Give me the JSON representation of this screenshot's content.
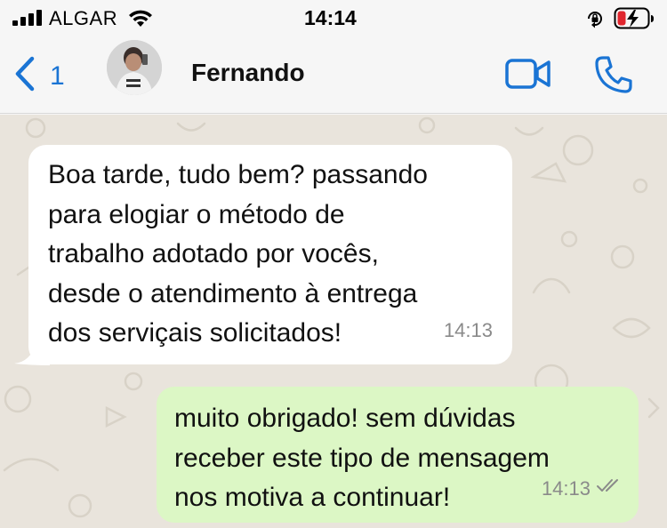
{
  "status_bar": {
    "carrier": "ALGAR",
    "time": "14:14",
    "icons": [
      "signal-icon",
      "wifi-icon",
      "orientation-lock-icon",
      "battery-charging-icon"
    ]
  },
  "header": {
    "back_count": "1",
    "contact_name": "Fernando",
    "icons": [
      "back-chevron-icon",
      "video-call-icon",
      "phone-call-icon"
    ]
  },
  "messages": [
    {
      "direction": "incoming",
      "text": "Boa tarde, tudo bem? passando\npara elogiar o método de\ntrabalho adotado por vocês,\ndesde o atendimento à entrega\ndos serviçais solicitados!",
      "time": "14:13"
    },
    {
      "direction": "outgoing",
      "text": "muito obrigado! sem dúvidas\nreceber este tipo de mensagem\nnos motiva a continuar!",
      "time": "14:13",
      "status": "read-double-check-icon"
    }
  ],
  "colors": {
    "accent": "#1a74d4",
    "chat_background": "#e9e4dc",
    "incoming_bubble": "#ffffff",
    "outgoing_bubble": "#dcf7c5",
    "timestamp": "#8a8a8a"
  }
}
